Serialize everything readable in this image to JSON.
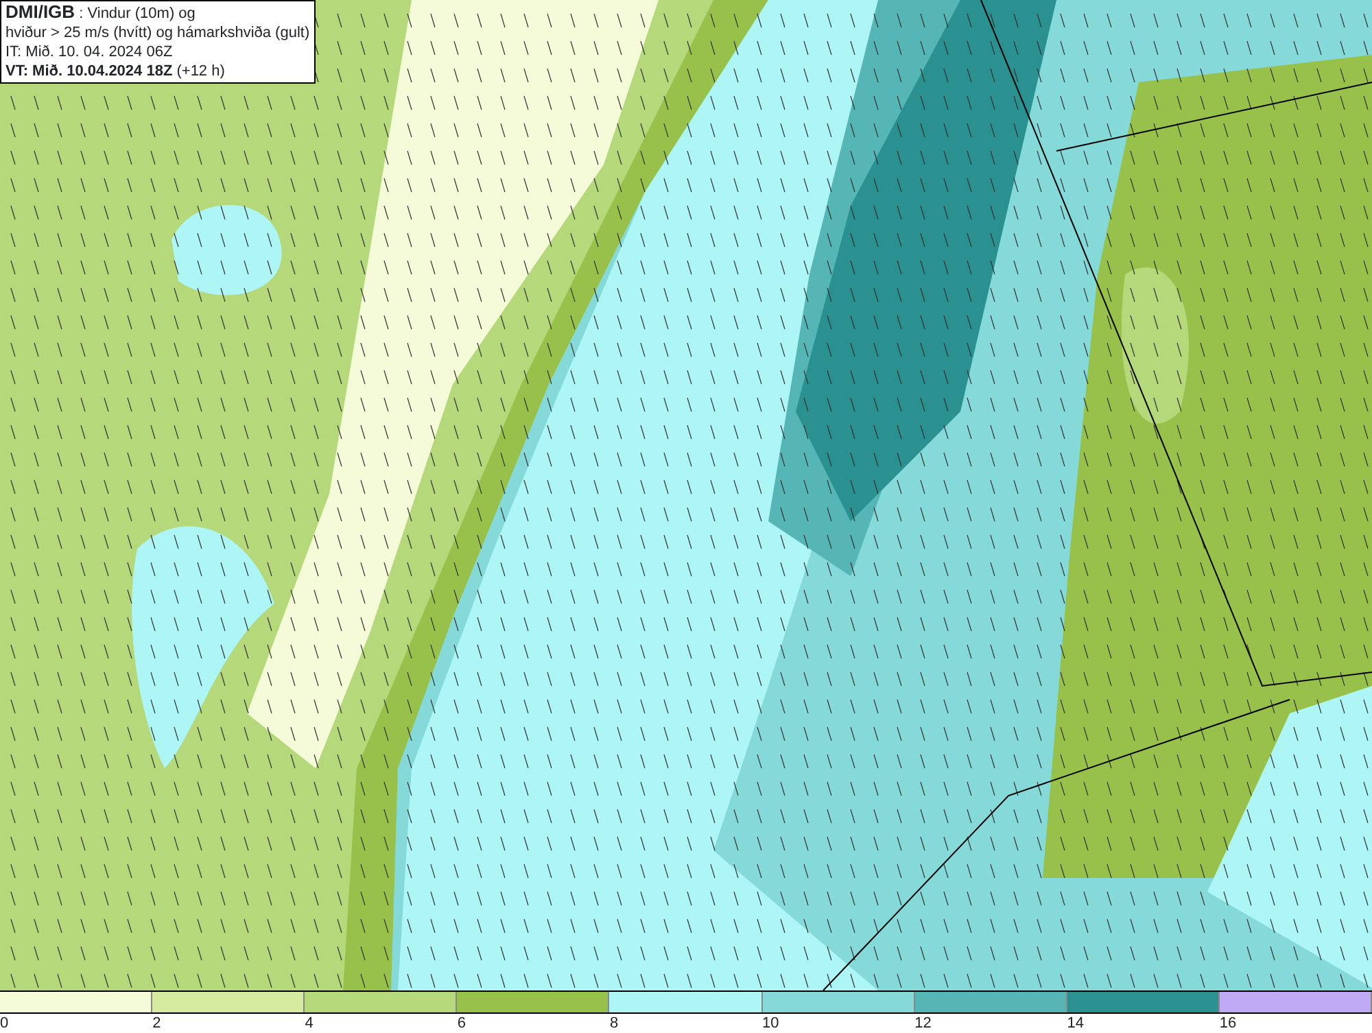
{
  "header": {
    "lines": [
      "**DMI/IGB** : Vindur (10m) og",
      "hviður > 25 m/s (hvítt) og hámarkshviða (gult)",
      "IT: Mið. 10. 04. 2024 06Z",
      "**VT: Mið. 10.04.2024 18Z** (+12 h)"
    ]
  },
  "legend": {
    "bins": [
      {
        "label": "0",
        "color": "#f5fbd8"
      },
      {
        "label": "2",
        "color": "#d6eba0"
      },
      {
        "label": "4",
        "color": "#b5d97a"
      },
      {
        "label": "6",
        "color": "#97c14a"
      },
      {
        "label": "8",
        "color": "#aef5f5"
      },
      {
        "label": "10",
        "color": "#86d9d9"
      },
      {
        "label": "12",
        "color": "#56b5b5"
      },
      {
        "label": "14",
        "color": "#2a9090"
      },
      {
        "label": "16",
        "color": "#c0aaf5"
      }
    ]
  }
}
